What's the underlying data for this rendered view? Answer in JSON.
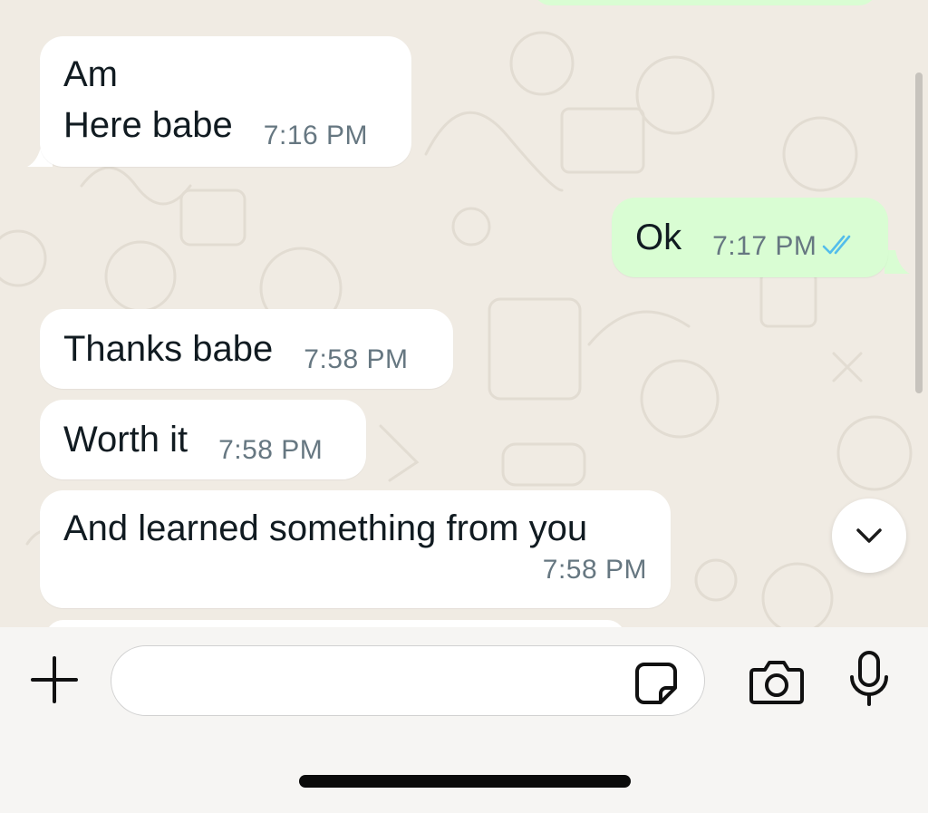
{
  "messages": [
    {
      "direction": "in",
      "lines": [
        "Am",
        "Here babe"
      ],
      "time": "7:16 PM"
    },
    {
      "direction": "out",
      "text": "Ok",
      "time": "7:17 PM",
      "status": "read"
    },
    {
      "direction": "in",
      "text": "Thanks babe",
      "time": "7:58 PM"
    },
    {
      "direction": "in",
      "text": "Worth it",
      "time": "7:58 PM"
    },
    {
      "direction": "in",
      "text": "And learned something from you",
      "time": "7:58 PM"
    }
  ],
  "input": {
    "value": "",
    "placeholder": ""
  },
  "icons": {
    "attach": "plus-icon",
    "sticker": "sticker-icon",
    "camera": "camera-icon",
    "mic": "microphone-icon",
    "scroll_down": "chevron-down-icon",
    "read_receipt": "double-check-icon"
  },
  "colors": {
    "incoming_bubble": "#ffffff",
    "outgoing_bubble": "#d9fdd3",
    "chat_background": "#f0ebe3",
    "timestamp": "#667781",
    "read_receipt": "#53bdeb"
  }
}
